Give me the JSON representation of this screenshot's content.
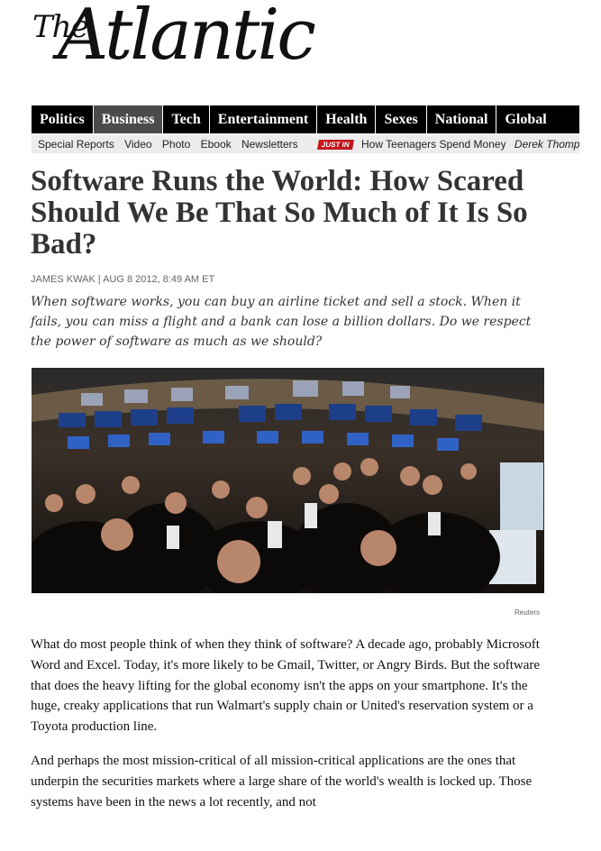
{
  "masthead": {
    "the": "The",
    "name": "Atlantic"
  },
  "nav": {
    "main": [
      {
        "label": "Politics",
        "active": false
      },
      {
        "label": "Business",
        "active": true
      },
      {
        "label": "Tech",
        "active": false
      },
      {
        "label": "Entertainment",
        "active": false
      },
      {
        "label": "Health",
        "active": false
      },
      {
        "label": "Sexes",
        "active": false
      },
      {
        "label": "National",
        "active": false
      },
      {
        "label": "Global",
        "active": false
      }
    ],
    "sub": [
      "Special Reports",
      "Video",
      "Photo",
      "Ebook",
      "Newsletters"
    ],
    "just_in_badge": "JUST IN",
    "just_in_headline": "How Teenagers Spend Money",
    "just_in_author": "Derek Thompson"
  },
  "article": {
    "title": "Software Runs the World: How Scared Should We Be That So Much of It Is So Bad?",
    "byline": "JAMES KWAK | AUG 8 2012, 8:49 AM ET",
    "dek": "When software works, you can buy an airline ticket and sell a stock. When it fails, you can miss a flight and a bank can lose a billion dollars. Do we respect the power of software as much as we should?",
    "photo_credit": "Reuters",
    "paragraphs": [
      "What do most people think of when they think of software? A decade ago, probably Microsoft Word and Excel. Today, it's more likely to be Gmail, Twitter, or Angry Birds. But the software that does the heavy lifting for the global economy isn't the apps on your smartphone. It's the huge, creaky applications that run Walmart's supply chain or United's reservation system or a Toyota production line.",
      "And perhaps the most mission-critical of all mission-critical applications are the ones that underpin the securities markets where a large share of the world's wealth is locked up. Those systems have been in the news a lot recently, and not"
    ]
  },
  "colors": {
    "nav_bg": "#000000",
    "nav_active": "#4b4b4b",
    "subnav_bg": "#ececec",
    "badge": "#c4161c"
  }
}
